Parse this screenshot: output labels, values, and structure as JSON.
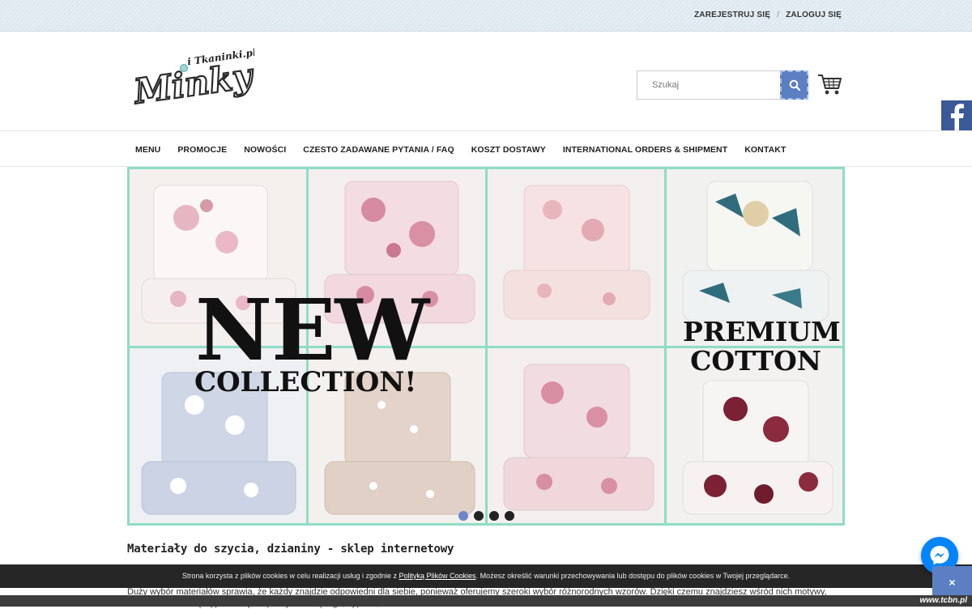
{
  "topbar": {
    "register": "Zarejestruj się",
    "separator": "/",
    "login": "Zaloguj się"
  },
  "logo": {
    "text_main": "Minky",
    "text_sub": "i Tkaninki.pl"
  },
  "search": {
    "placeholder": "Szukaj"
  },
  "icons": {
    "search": "search-icon",
    "cart": "cart-icon",
    "facebook": "facebook-icon",
    "messenger": "messenger-icon",
    "close": "close-icon"
  },
  "nav": {
    "items": [
      "Menu",
      "Promocje",
      "Nowości",
      "Czesto zadawane pytania / FAQ",
      "Koszt dostawy",
      "International orders & shipment",
      "Kontakt"
    ]
  },
  "banner": {
    "headline": "NEW",
    "subheadline": "COLLECTION!",
    "badge_line1": "PREMIUM",
    "badge_line2": "COTTON",
    "slides": 4,
    "active_slide": 1
  },
  "main": {
    "heading": "Materiały do szycia, dzianiny - sklep internetowy",
    "intro": "Duży wybór materiałów sprawia, że każdy znajdzie odpowiedni dla siebie, ponieważ oferujemy szeroki wybór różnorodnych wzorów. Dzięki czemu znajdziesz wśród nich motywy, które doskonale będą pasowały do pokoju dziecięcego, sypialni, a także salonu."
  },
  "cookie": {
    "text_before": "Strona korzysta z plików cookies w celu realizacji usług i zgodnie z ",
    "link": "Polityką Plików Cookies",
    "text_after": ". Możesz określić warunki przechowywania lub dostępu do plików cookies w Twojej przeglądarce.",
    "close": "×"
  },
  "watermark": "www.tcbn.pl",
  "colors": {
    "accent": "#5b7fc2",
    "facebook": "#3b5998",
    "messenger": "#0084ff",
    "banner_frame": "#8fdcc7"
  }
}
